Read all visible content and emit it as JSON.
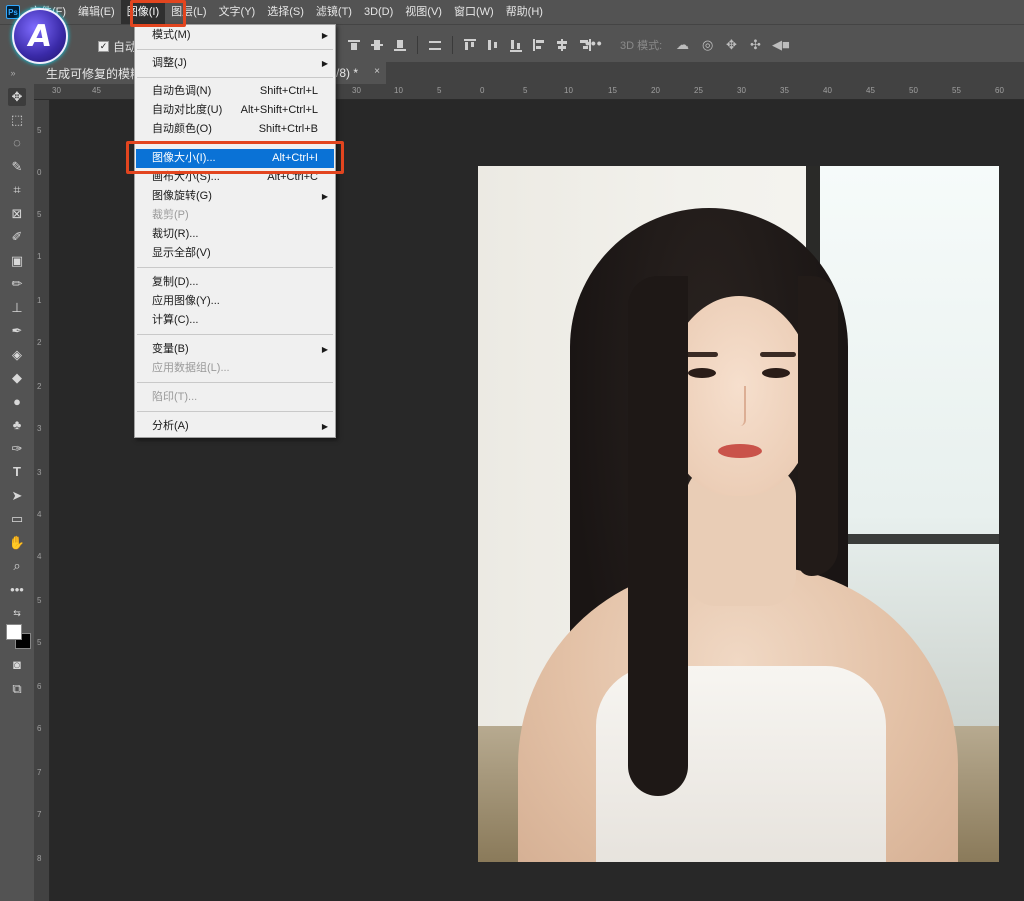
{
  "menubar": {
    "app_logo": "Ps",
    "items": [
      "文件(F)",
      "编辑(E)",
      "图像(I)",
      "图层(L)",
      "文字(Y)",
      "选择(S)",
      "滤镜(T)",
      "3D(D)",
      "视图(V)",
      "窗口(W)",
      "帮助(H)"
    ],
    "active_index": 2
  },
  "badge": {
    "letter": "A"
  },
  "options": {
    "auto_select_label": "自动",
    "mode_3d_label": "3D 模式:",
    "more": "•••"
  },
  "document": {
    "tab_title": "生成可修复的模糊",
    "tab_suffix": "/8) *",
    "close": "×"
  },
  "ruler": {
    "h_ticks": [
      "30",
      "45",
      "35",
      "30",
      "25",
      "20",
      "15",
      "10",
      "5",
      "0",
      "5",
      "10",
      "15",
      "20",
      "25",
      "30",
      "35",
      "40",
      "45",
      "50",
      "55",
      "60"
    ],
    "v_ticks": [
      "5",
      "0",
      "5",
      "1",
      "1",
      "2",
      "2",
      "3",
      "3",
      "4",
      "4",
      "5",
      "5",
      "6",
      "6",
      "7",
      "7",
      "8"
    ]
  },
  "image_menu": {
    "items": [
      {
        "label": "模式(M)",
        "shortcut": "",
        "submenu": true,
        "disabled": false
      },
      {
        "label": "调整(J)",
        "shortcut": "",
        "submenu": true,
        "disabled": false
      },
      {
        "label": "自动色调(N)",
        "shortcut": "Shift+Ctrl+L",
        "submenu": false,
        "disabled": false
      },
      {
        "label": "自动对比度(U)",
        "shortcut": "Alt+Shift+Ctrl+L",
        "submenu": false,
        "disabled": false
      },
      {
        "label": "自动颜色(O)",
        "shortcut": "Shift+Ctrl+B",
        "submenu": false,
        "disabled": false
      },
      {
        "label": "图像大小(I)...",
        "shortcut": "Alt+Ctrl+I",
        "submenu": false,
        "disabled": false
      },
      {
        "label": "画布大小(S)...",
        "shortcut": "Alt+Ctrl+C",
        "submenu": false,
        "disabled": false
      },
      {
        "label": "图像旋转(G)",
        "shortcut": "",
        "submenu": true,
        "disabled": false
      },
      {
        "label": "裁剪(P)",
        "shortcut": "",
        "submenu": false,
        "disabled": true
      },
      {
        "label": "裁切(R)...",
        "shortcut": "",
        "submenu": false,
        "disabled": false
      },
      {
        "label": "显示全部(V)",
        "shortcut": "",
        "submenu": false,
        "disabled": false
      },
      {
        "label": "复制(D)...",
        "shortcut": "",
        "submenu": false,
        "disabled": false
      },
      {
        "label": "应用图像(Y)...",
        "shortcut": "",
        "submenu": false,
        "disabled": false
      },
      {
        "label": "计算(C)...",
        "shortcut": "",
        "submenu": false,
        "disabled": false
      },
      {
        "label": "变量(B)",
        "shortcut": "",
        "submenu": true,
        "disabled": false
      },
      {
        "label": "应用数据组(L)...",
        "shortcut": "",
        "submenu": false,
        "disabled": true
      },
      {
        "label": "陷印(T)...",
        "shortcut": "",
        "submenu": false,
        "disabled": true
      },
      {
        "label": "分析(A)",
        "shortcut": "",
        "submenu": true,
        "disabled": false
      }
    ],
    "highlighted_index": 5
  },
  "colors": {
    "highlight": "#0a72d6",
    "annotation": "#e2451f",
    "panel": "#535353",
    "canvas": "#282828"
  }
}
